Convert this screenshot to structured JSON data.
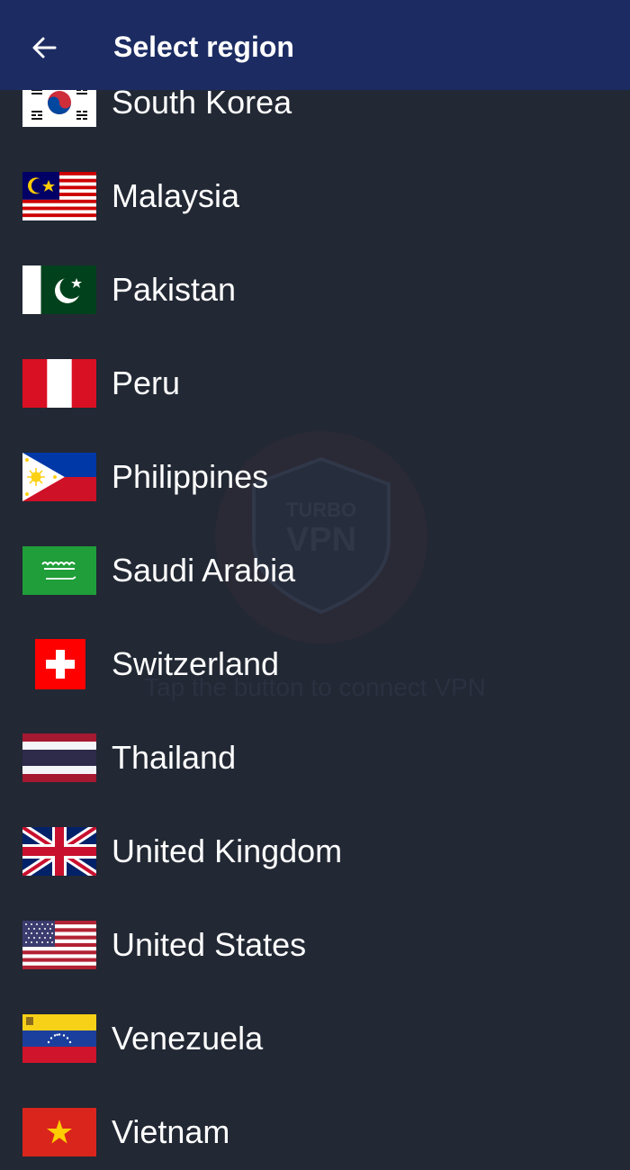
{
  "header": {
    "title": "Select region",
    "back_icon": "arrow-left-icon",
    "background": "#1c2c63"
  },
  "watermark": {
    "logo_line1": "TURBO",
    "logo_line2": "VPN",
    "hint": "Tap the button to connect VPN"
  },
  "regions": [
    {
      "label": "South Korea",
      "flag": "south-korea-flag-icon"
    },
    {
      "label": "Malaysia",
      "flag": "malaysia-flag-icon"
    },
    {
      "label": "Pakistan",
      "flag": "pakistan-flag-icon"
    },
    {
      "label": "Peru",
      "flag": "peru-flag-icon"
    },
    {
      "label": "Philippines",
      "flag": "philippines-flag-icon"
    },
    {
      "label": "Saudi Arabia",
      "flag": "saudi-arabia-flag-icon"
    },
    {
      "label": "Switzerland",
      "flag": "switzerland-flag-icon"
    },
    {
      "label": "Thailand",
      "flag": "thailand-flag-icon"
    },
    {
      "label": "United Kingdom",
      "flag": "united-kingdom-flag-icon"
    },
    {
      "label": "United States",
      "flag": "united-states-flag-icon"
    },
    {
      "label": "Venezuela",
      "flag": "venezuela-flag-icon"
    },
    {
      "label": "Vietnam",
      "flag": "vietnam-flag-icon"
    }
  ],
  "colors": {
    "background": "#222834",
    "text": "#ffffff"
  }
}
